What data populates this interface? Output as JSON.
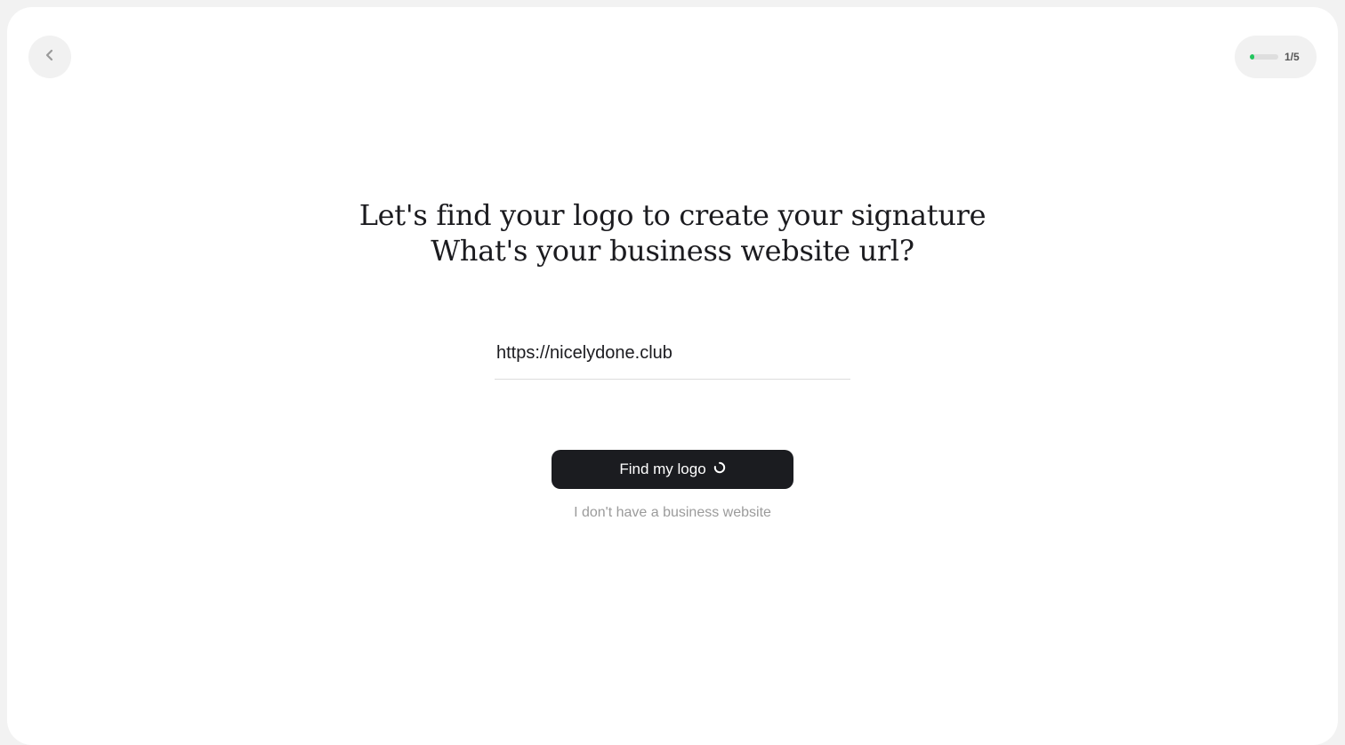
{
  "header": {
    "back_icon": "chevron-left-icon",
    "progress": {
      "fraction": 0.15,
      "fill_color": "#22c55e",
      "label": "1/5"
    }
  },
  "main": {
    "title_line_1": "Let's find your logo to create your signature",
    "title_line_2": "What's your business website url?",
    "url_input": {
      "value": "https://nicelydone.club"
    },
    "primary_button": {
      "label": "Find my logo",
      "icon": "spinner-icon"
    },
    "secondary_link": "I don't have a business website"
  },
  "colors": {
    "accent": "#22c55e",
    "button_bg": "#1b1c20",
    "muted_text": "#9b9b9b"
  }
}
